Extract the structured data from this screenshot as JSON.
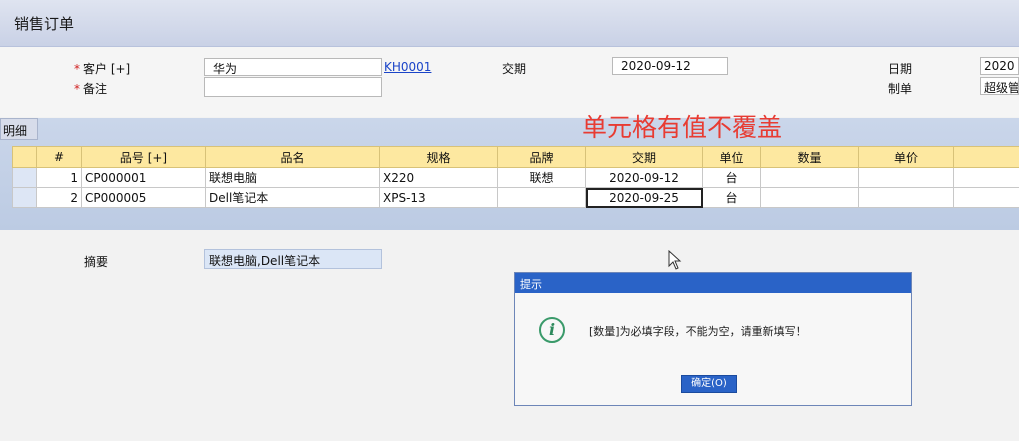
{
  "window": {
    "title": "销售订单"
  },
  "header_form": {
    "customer_label": "客户 [+]",
    "customer_value": "华为",
    "customer_code": "KH0001",
    "delivery_label": "交期",
    "delivery_value": "2020-09-12",
    "date_label": "日期",
    "date_value": "2020",
    "note_label": "备注",
    "note_value": "",
    "maker_label": "制单",
    "maker_value": "超级管"
  },
  "detail": {
    "tab_label": "明细",
    "overlay_text": "单元格有值不覆盖",
    "columns": [
      "#",
      "品号 [+]",
      "品名",
      "规格",
      "品牌",
      "交期",
      "单位",
      "数量",
      "单价"
    ],
    "rows": [
      {
        "no": "1",
        "code": "CP000001",
        "name": "联想电脑",
        "spec": "X220",
        "brand": "联想",
        "delivery": "2020-09-12",
        "unit": "台",
        "qty": "",
        "price": ""
      },
      {
        "no": "2",
        "code": "CP000005",
        "name": "Dell笔记本",
        "spec": "XPS-13",
        "brand": "",
        "delivery": "2020-09-25",
        "unit": "台",
        "qty": "",
        "price": ""
      }
    ]
  },
  "summary": {
    "label": "摘要",
    "value": "联想电脑,Dell笔记本"
  },
  "dialog": {
    "title": "提示",
    "icon": "info-icon",
    "message": "[数量]为必填字段，不能为空，请重新填写！",
    "ok_label": "确定(O)"
  },
  "colors": {
    "title_bar": "#c9d1e6",
    "grid_header": "#fde8a0",
    "overlay_text": "#e83b32",
    "dialog_title": "#2a63c7"
  }
}
